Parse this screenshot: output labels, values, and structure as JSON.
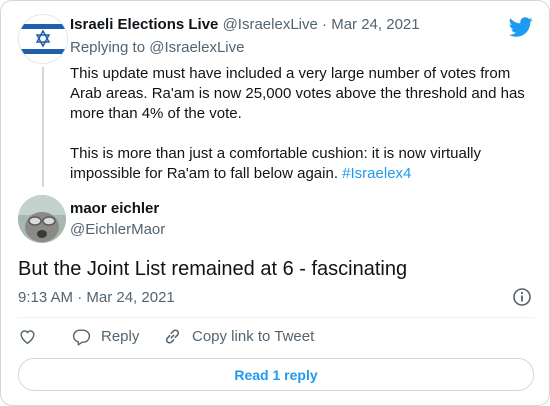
{
  "parent_tweet": {
    "author_name": "Israeli Elections Live",
    "author_handle": "@IsraelexLive",
    "separator": " · ",
    "date": "Mar 24, 2021",
    "replying_prefix": "Replying to ",
    "replying_handle": "@IsraelexLive",
    "paragraph_1": "This update must have included a very large number of votes from Arab areas. Ra'am is now 25,000 votes above the threshold and has more than 4% of the vote.",
    "paragraph_2": "This is more than just a comfortable cushion: it is now virtually impossible for Ra'am to fall below again. ",
    "hashtag": "#Israelex4"
  },
  "main_tweet": {
    "author_name": "maor eichler",
    "author_handle": "@EichlerMaor",
    "text": "But the Joint List remained at 6 - fascinating",
    "timestamp": "9:13 AM · Mar 24, 2021"
  },
  "actions": {
    "reply_label": "Reply",
    "copy_link_label": "Copy link to Tweet"
  },
  "read_reply_label": "Read 1 reply",
  "icons": {
    "brand": "twitter-bird-icon",
    "like": "heart-icon",
    "reply": "reply-bubble-icon",
    "copy": "link-icon",
    "info": "info-icon"
  },
  "colors": {
    "accent": "#1d9bf0",
    "text": "#0f1419",
    "muted": "#536471",
    "border": "#cfd9de"
  }
}
